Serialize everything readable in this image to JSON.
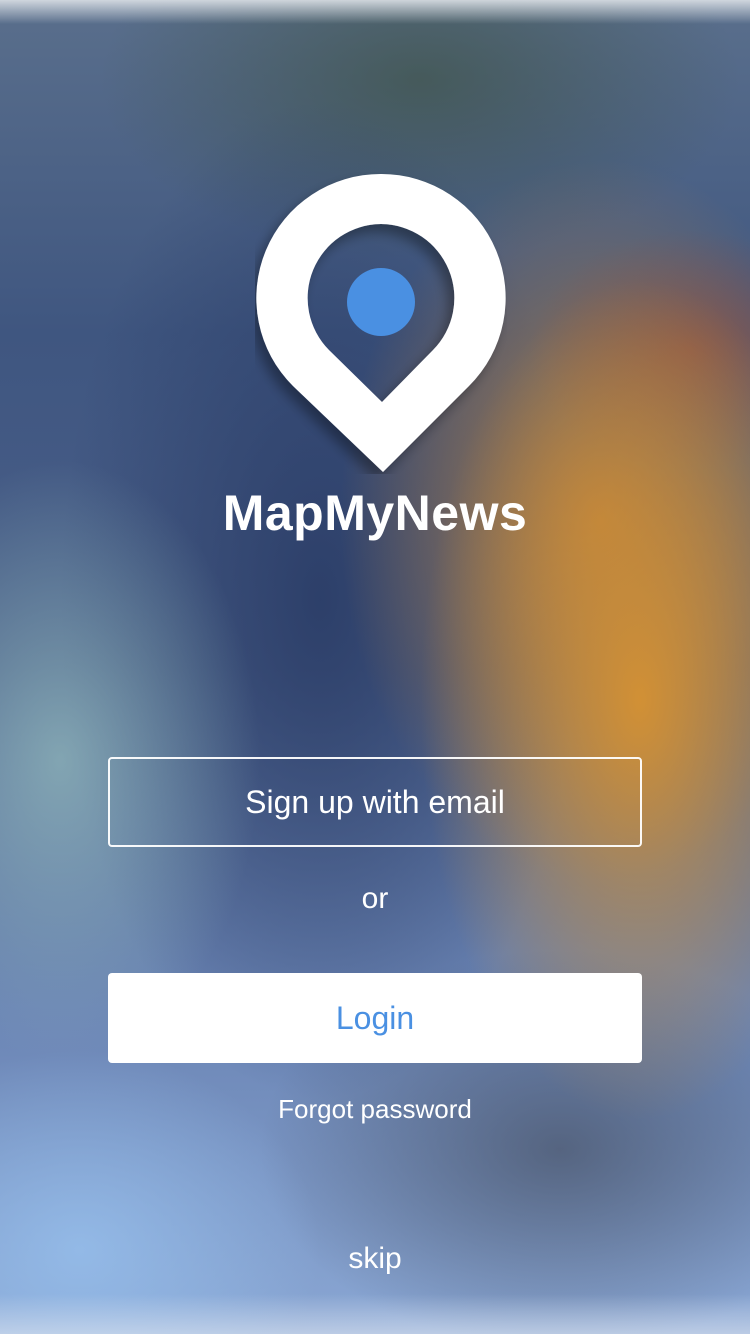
{
  "app": {
    "name": "MapMyNews",
    "logo_icon": "map-pin-icon",
    "accent_color": "#4a90e2"
  },
  "actions": {
    "signup_label": "Sign up with email",
    "separator": "or",
    "login_label": "Login",
    "forgot_password_label": "Forgot password",
    "skip_label": "skip"
  }
}
